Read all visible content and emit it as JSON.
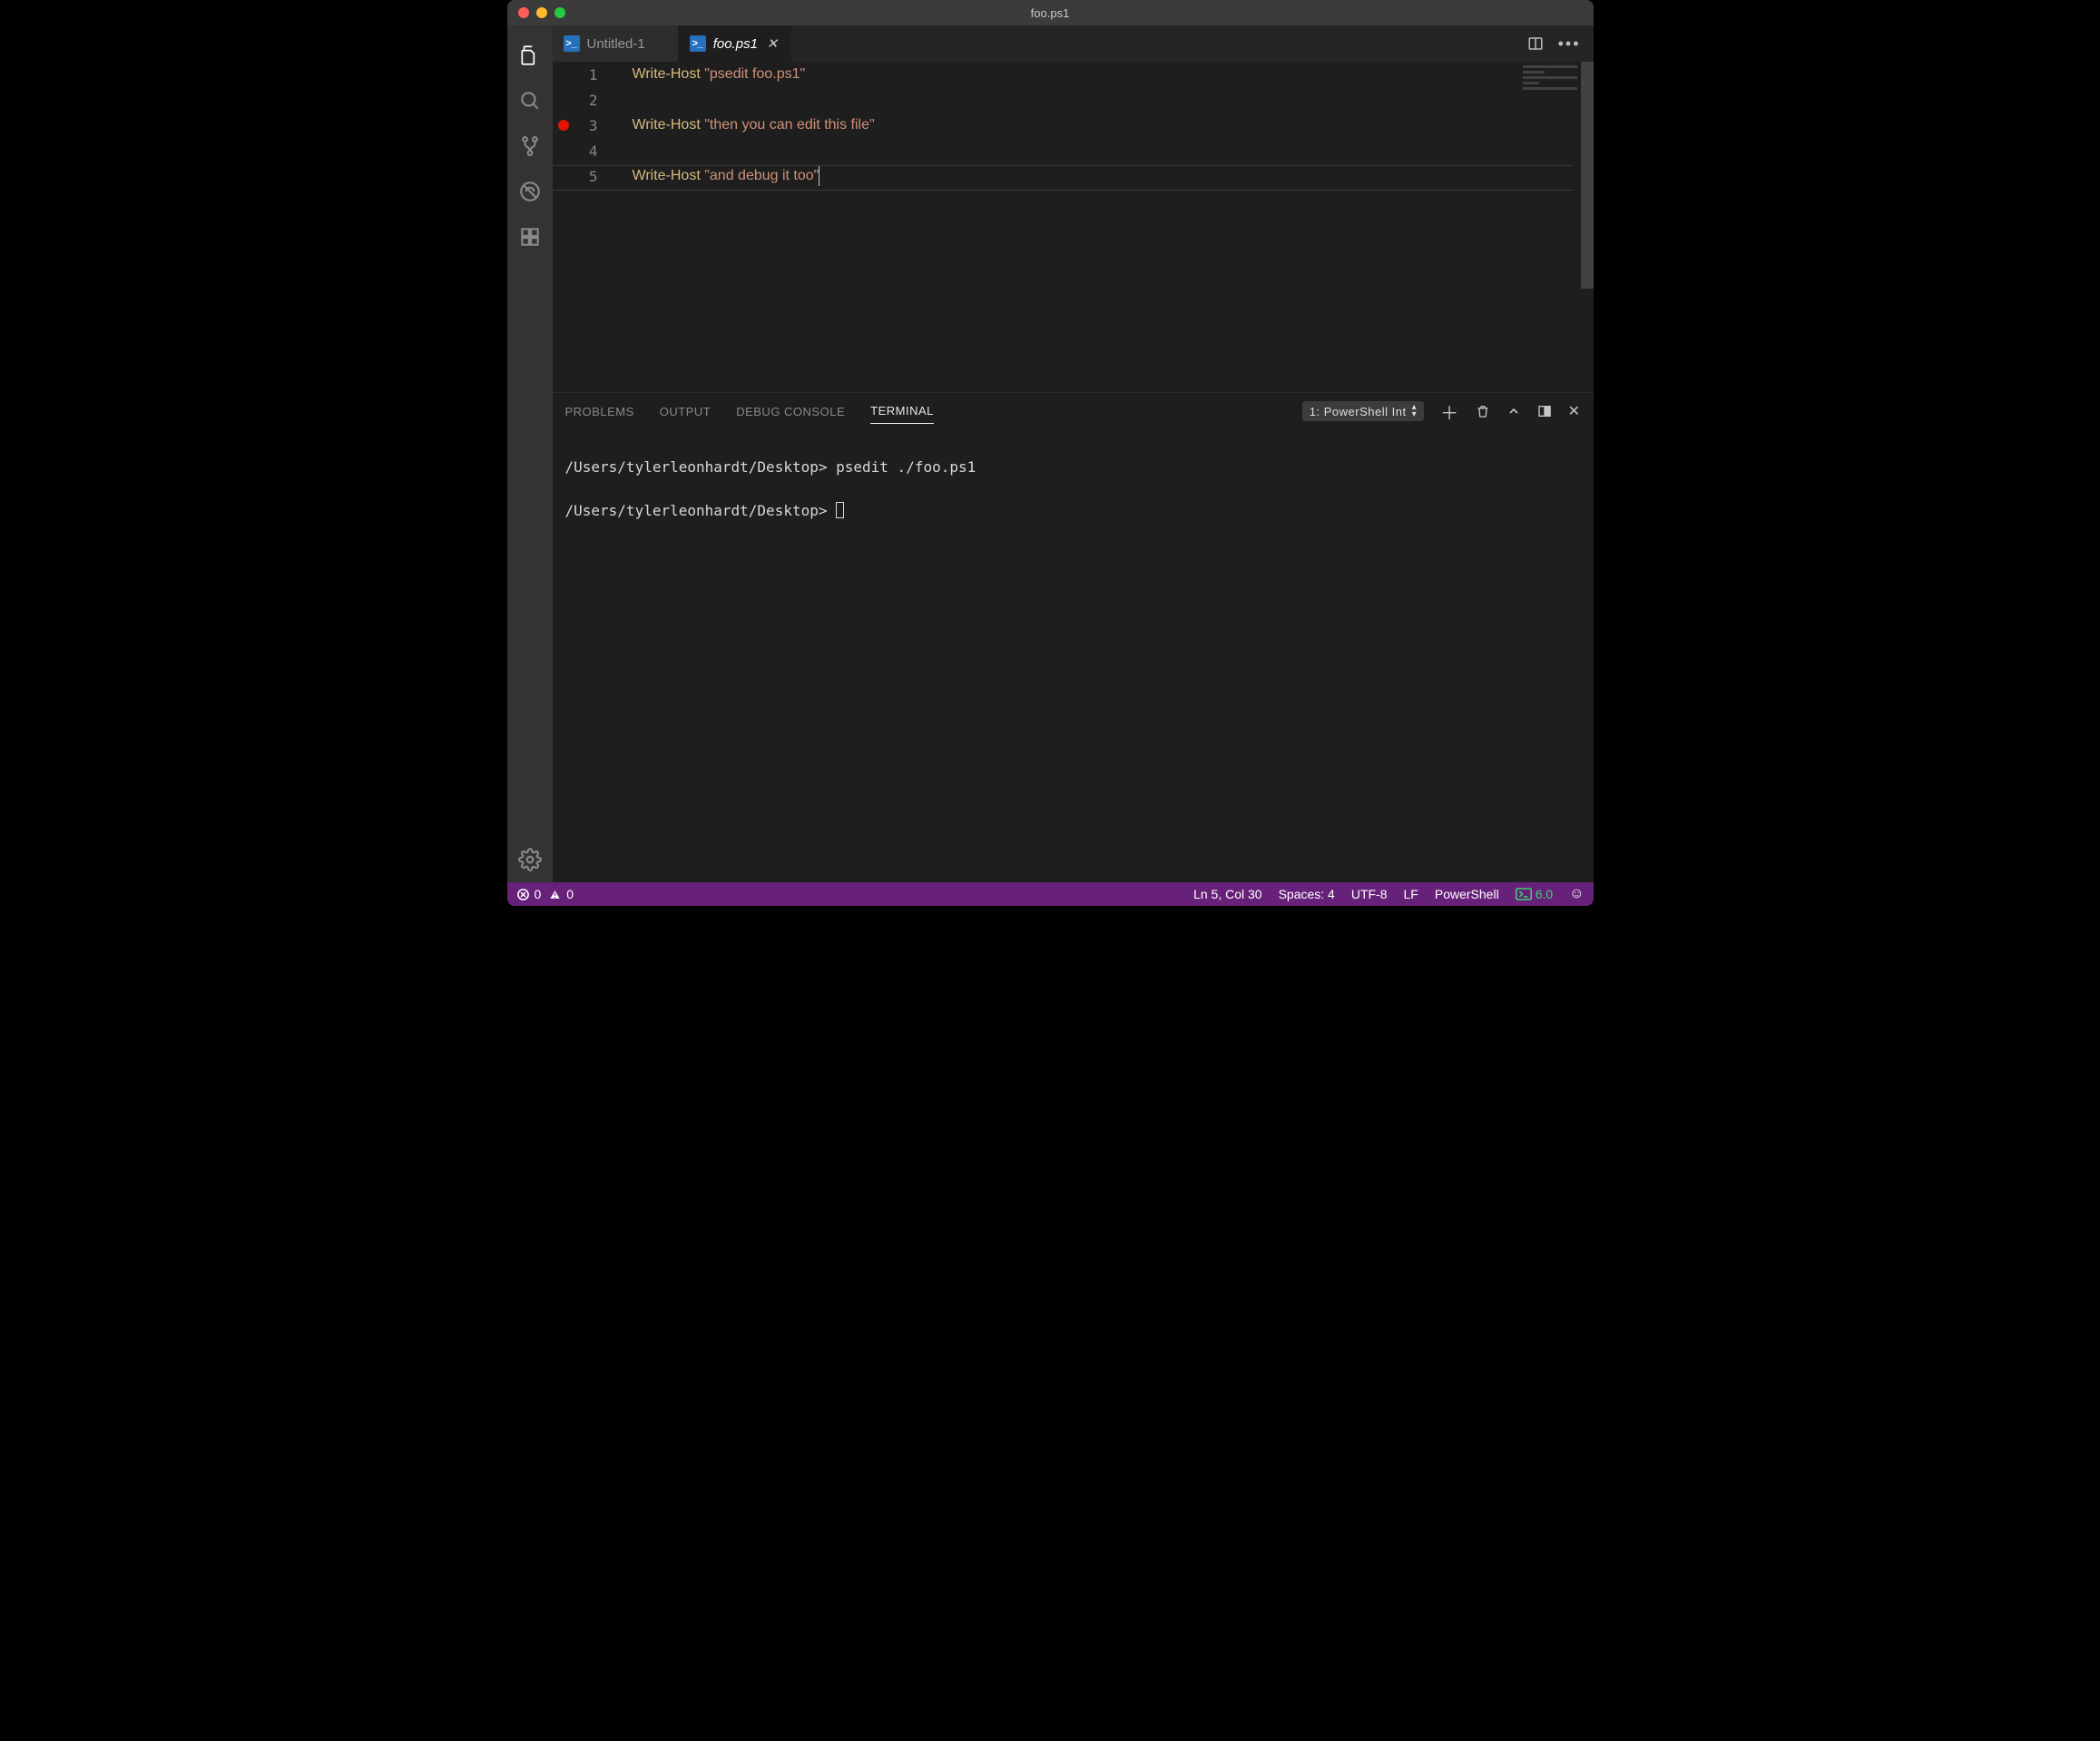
{
  "window": {
    "title": "foo.ps1"
  },
  "tabs": [
    {
      "label": "Untitled-1",
      "active": false
    },
    {
      "label": "foo.ps1",
      "active": true
    }
  ],
  "editor": {
    "lines": [
      {
        "n": 1,
        "cmd": "Write-Host",
        "str": "\"psedit foo.ps1\"",
        "bp": false
      },
      {
        "n": 2,
        "cmd": "",
        "str": "",
        "bp": false
      },
      {
        "n": 3,
        "cmd": "Write-Host",
        "str": "\"then you can edit this file\"",
        "bp": true
      },
      {
        "n": 4,
        "cmd": "",
        "str": "",
        "bp": false
      },
      {
        "n": 5,
        "cmd": "Write-Host",
        "str": "\"and debug it too\"",
        "bp": false
      }
    ],
    "cursor_line": 5
  },
  "panel": {
    "tabs": {
      "problems": "PROBLEMS",
      "output": "OUTPUT",
      "debug": "DEBUG CONSOLE",
      "terminal": "TERMINAL"
    },
    "terminal_picker": "1: PowerShell Int",
    "terminal_lines": [
      {
        "prompt": "/Users/tylerleonhardt/Desktop>",
        "cmd": "psedit ./foo.ps1"
      },
      {
        "prompt": "/Users/tylerleonhardt/Desktop>",
        "cmd": ""
      }
    ]
  },
  "status": {
    "errors": "0",
    "warnings": "0",
    "cursor": "Ln 5, Col 30",
    "indent": "Spaces: 4",
    "encoding": "UTF-8",
    "eol": "LF",
    "language": "PowerShell",
    "ps_version": "6.0"
  }
}
